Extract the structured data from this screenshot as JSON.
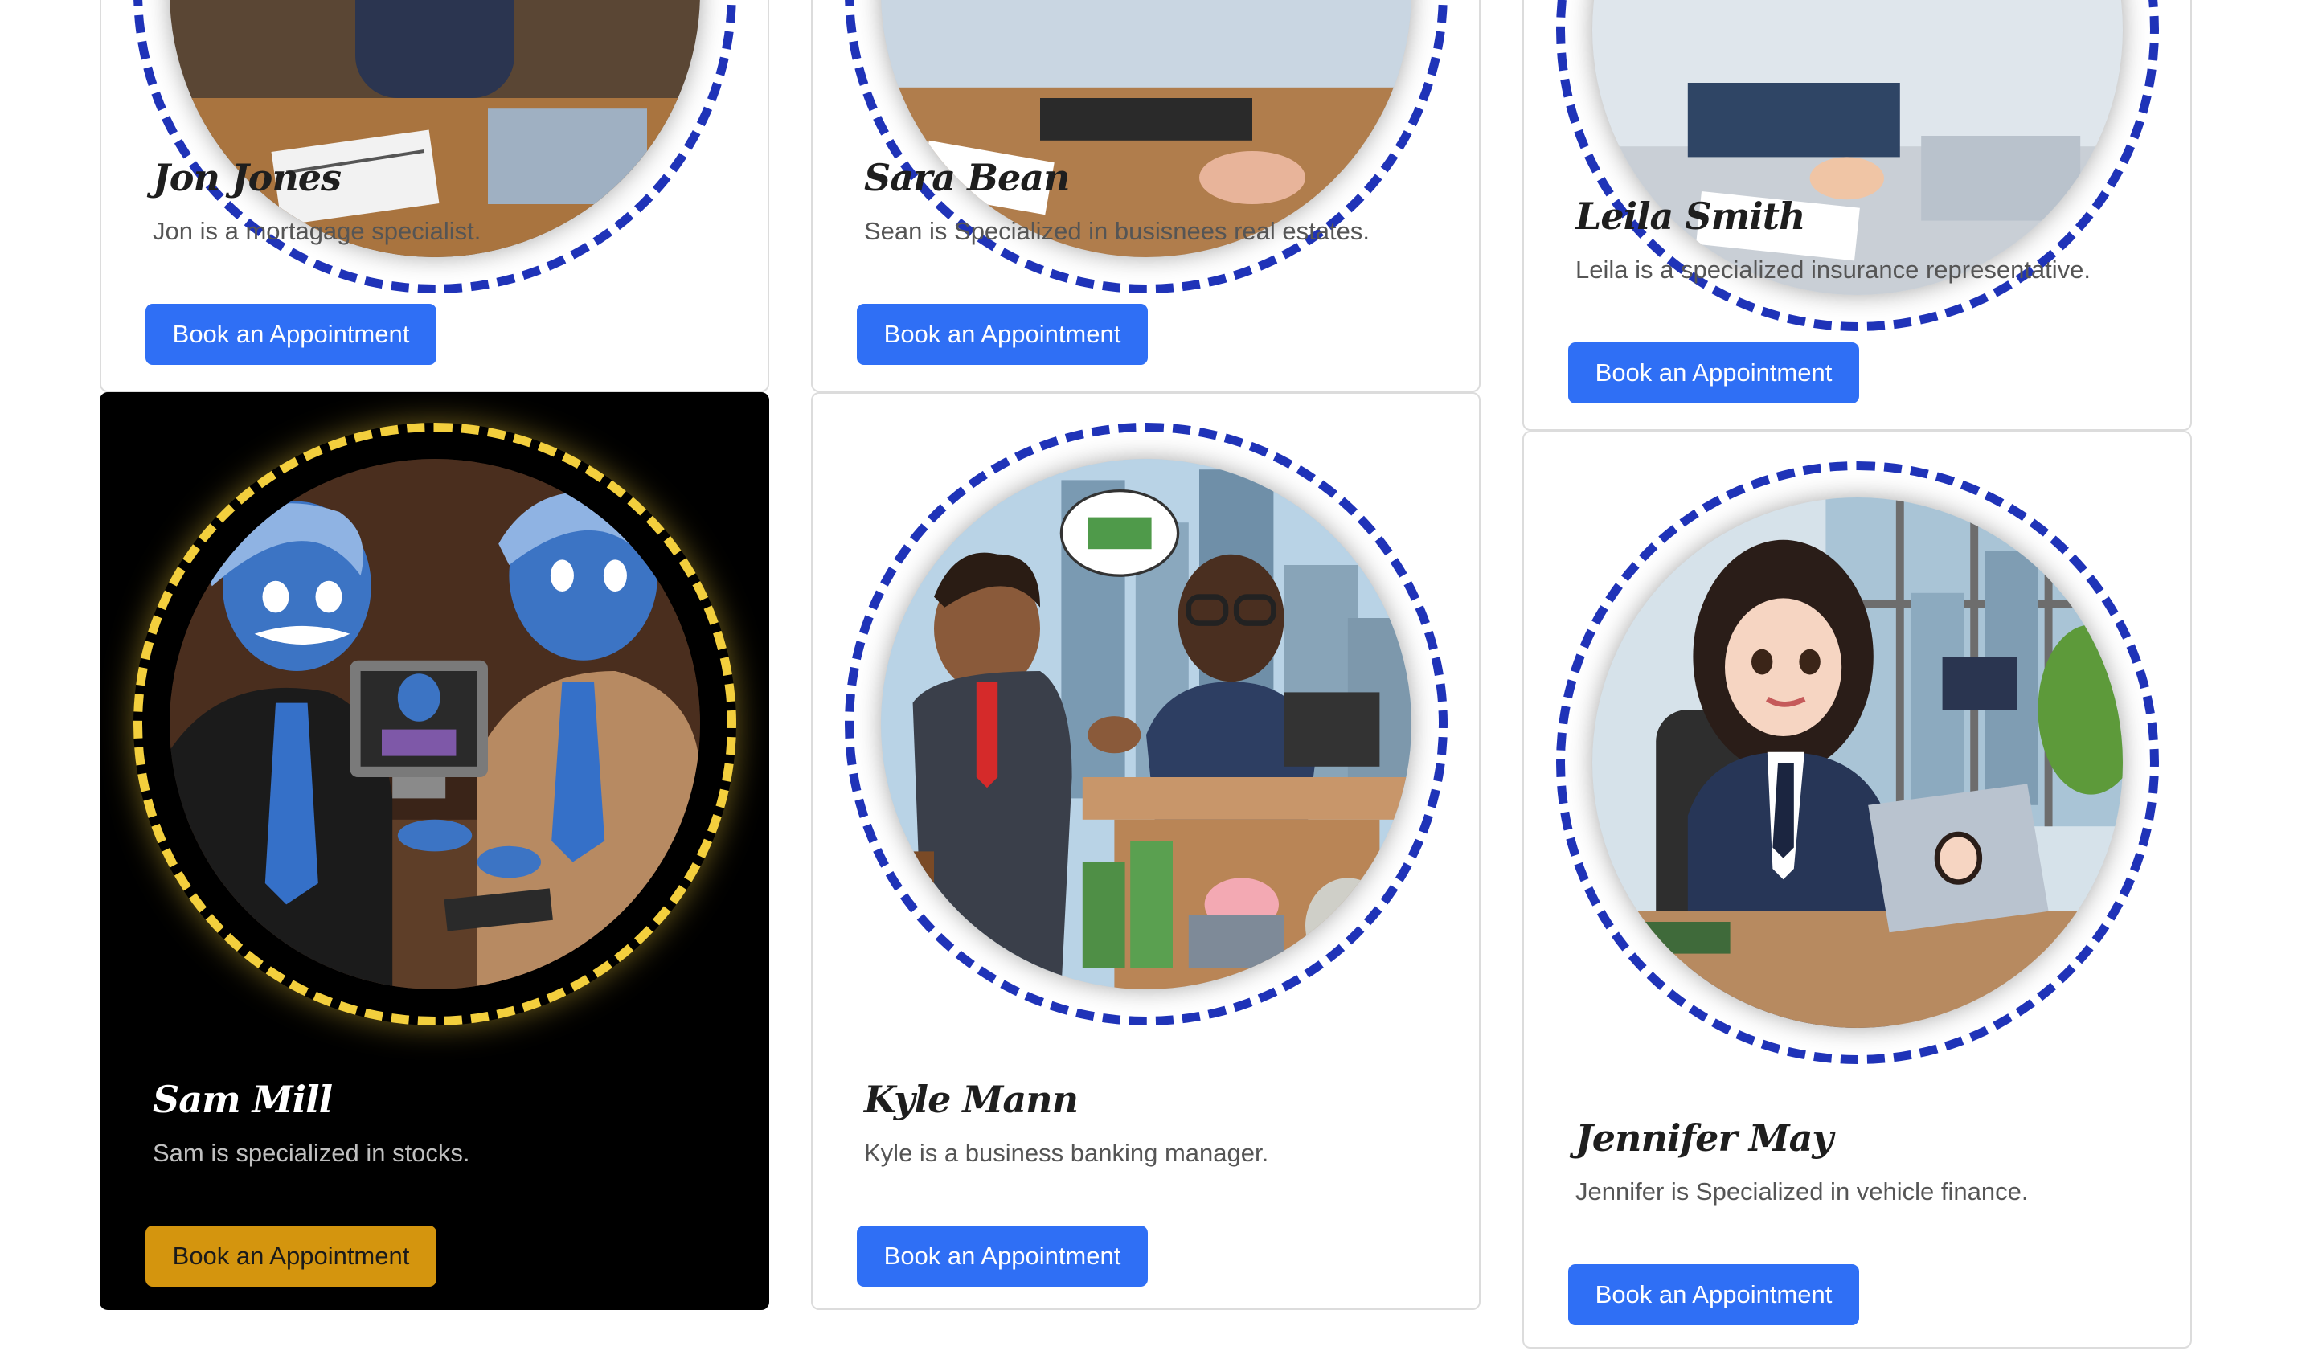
{
  "cards": [
    {
      "name": "Jon Jones",
      "description": "Jon is a mortagage specialist.",
      "button": "Book an Appointment"
    },
    {
      "name": "Sara Bean",
      "description": "Sean is Specialized in busisnees real estates.",
      "button": "Book an Appointment"
    },
    {
      "name": "Leila Smith",
      "description": "Leila is a specialized insurance representative.",
      "button": "Book an Appointment"
    },
    {
      "name": "Sam Mill",
      "description": "Sam is specialized in stocks.",
      "button": "Book an Appointment"
    },
    {
      "name": "Kyle Mann",
      "description": "Kyle is a business banking manager.",
      "button": "Book an Appointment"
    },
    {
      "name": "Jennifer May",
      "description": "Jennifer is Specialized in vehicle finance.",
      "button": "Book an Appointment"
    }
  ],
  "colors": {
    "button_blue": "#2f6ff5",
    "button_gold": "#d4950e",
    "dashed_ring_blue": "#1f33b8",
    "dashed_ring_yellow": "#f3cf3d",
    "dark_card": "#000000"
  }
}
